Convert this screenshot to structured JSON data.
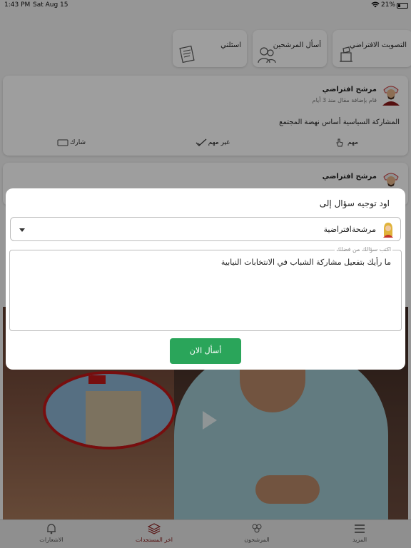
{
  "status_bar": {
    "time": "1:43 PM",
    "date": "Sat Aug 15",
    "battery": "21%"
  },
  "actions": {
    "vote": "التصويت الافتراضي",
    "ask_candidates": "أسأل المرشحين",
    "my_questions": "اسئلتي"
  },
  "feed": [
    {
      "name": "مرشح افتراضي",
      "sub": "قام بإضافة مقال منذ 3 أيام",
      "text": "المشاركة السياسية أساس نهضة المجتمع",
      "actions": {
        "important": "مهم",
        "not_important": "غير مهم",
        "share": "شارك"
      }
    },
    {
      "name": "مرشح افتراضي"
    }
  ],
  "modal": {
    "title": "اود توجيه سؤال إلى",
    "selected_candidate": "مرشحةافتراضية",
    "textarea_label": "اكتب سؤالك من فضلك",
    "textarea_value": "ما رأيك بتفعيل مشاركة الشباب في الانتخابات النيابية",
    "submit": "أسأل الان"
  },
  "tabs": {
    "more": "المزيد",
    "candidates": "المرشحون",
    "latest": "اخر المستجدات",
    "notifications": "الاشعارات"
  },
  "colors": {
    "accent": "#8a1a1a",
    "submit_button": "#2aa55a"
  }
}
